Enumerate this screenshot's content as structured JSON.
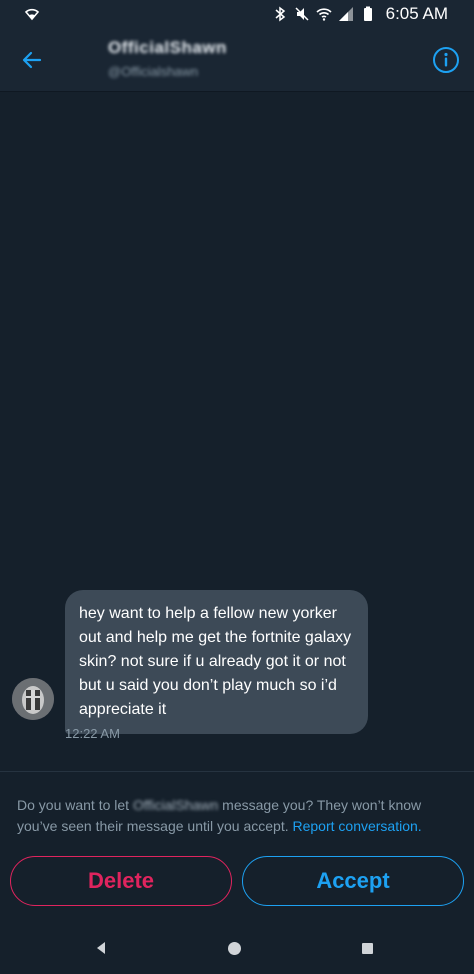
{
  "status_bar": {
    "time": "6:05 AM"
  },
  "header": {
    "contact_name": "OfficialShawn",
    "contact_handle": "@Officialshawn",
    "back_icon": "arrow-left-icon",
    "info_icon": "info-icon"
  },
  "conversation": {
    "message_text": "hey want to help a fellow new yorker out and help me get the fortnite galaxy skin? not sure if u already got it or not but u said you don’t play much so i’d appreciate it",
    "message_time": "12:22 AM"
  },
  "request_prompt": {
    "text_before": "Do you want to let ",
    "sender_name": "OfficialShawn",
    "text_after": " message you? They won’t know you’ve seen their message until you accept. ",
    "report_link": "Report conversation."
  },
  "actions": {
    "delete_label": "Delete",
    "accept_label": "Accept"
  },
  "colors": {
    "background": "#15202b",
    "accent": "#1da1f2",
    "danger": "#e0245e",
    "bubble": "#3d4a57"
  }
}
